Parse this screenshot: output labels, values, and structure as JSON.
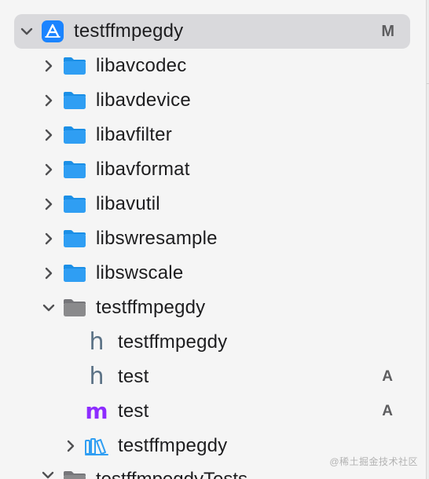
{
  "project": {
    "name": "testffmpegdy",
    "status": "M",
    "icon": "xcode-project-icon"
  },
  "items": [
    {
      "name": "libavcodec",
      "kind": "folder",
      "expanded": false
    },
    {
      "name": "libavdevice",
      "kind": "folder",
      "expanded": false
    },
    {
      "name": "libavfilter",
      "kind": "folder",
      "expanded": false
    },
    {
      "name": "libavformat",
      "kind": "folder",
      "expanded": false
    },
    {
      "name": "libavutil",
      "kind": "folder",
      "expanded": false
    },
    {
      "name": "libswresample",
      "kind": "folder",
      "expanded": false
    },
    {
      "name": "libswscale",
      "kind": "folder",
      "expanded": false
    },
    {
      "name": "testffmpegdy",
      "kind": "group",
      "expanded": true
    },
    {
      "name": "testffmpegdy",
      "kind": "header-file",
      "icon_text": "h"
    },
    {
      "name": "test",
      "kind": "header-file",
      "icon_text": "h",
      "status": "A"
    },
    {
      "name": "test",
      "kind": "objc-file",
      "icon_text": "m",
      "status": "A"
    },
    {
      "name": "testffmpegdy",
      "kind": "library-group",
      "expanded": false
    },
    {
      "name": "testffmpegdyTests",
      "kind": "group",
      "expanded": true
    }
  ],
  "watermark": "@稀土掘金技术社区",
  "colors": {
    "folder_blue": "#2f9ef3",
    "folder_gray": "#8a8a8c",
    "header_icon": "#5b7286",
    "objc_icon": "#8d2cff",
    "selection": "#d9d9dc",
    "app_blue": "#1b84ff"
  }
}
